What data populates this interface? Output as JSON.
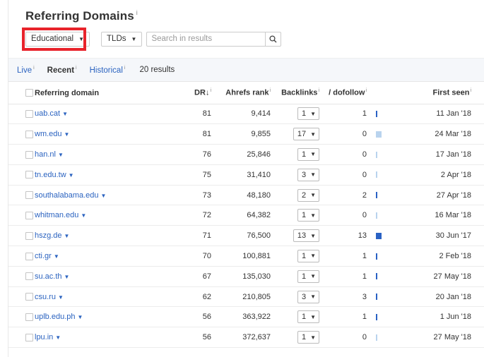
{
  "header": {
    "title": "Referring Domains",
    "title_info": "i"
  },
  "filters": {
    "category_label": "Educational",
    "tlds_label": "TLDs",
    "search_placeholder": "Search in results"
  },
  "tabs": [
    {
      "label": "Live",
      "info": "i"
    },
    {
      "label": "Recent",
      "info": "i"
    },
    {
      "label": "Historical",
      "info": "i"
    }
  ],
  "results_count": "20 results",
  "columns": {
    "domain": "Referring domain",
    "dr": "DR",
    "dr_sort_icon": "↓",
    "dr_info": "i",
    "rank": "Ahrefs rank",
    "rank_info": "i",
    "backlinks": "Backlinks",
    "backlinks_info": "i",
    "dofollow": "/ dofollow",
    "dofollow_info": "i",
    "first_seen": "First seen",
    "first_seen_info": "i"
  },
  "rows": [
    {
      "domain": "uab.cat",
      "dr": "81",
      "rank": "9,414",
      "backlinks": "1",
      "dofollow": "1",
      "first_seen": "11 Jan '18"
    },
    {
      "domain": "wm.edu",
      "dr": "81",
      "rank": "9,855",
      "backlinks": "17",
      "dofollow": "0",
      "first_seen": "24 Mar '18"
    },
    {
      "domain": "han.nl",
      "dr": "76",
      "rank": "25,846",
      "backlinks": "1",
      "dofollow": "0",
      "first_seen": "17 Jan '18"
    },
    {
      "domain": "tn.edu.tw",
      "dr": "75",
      "rank": "31,410",
      "backlinks": "3",
      "dofollow": "0",
      "first_seen": "2 Apr '18"
    },
    {
      "domain": "southalabama.edu",
      "dr": "73",
      "rank": "48,180",
      "backlinks": "2",
      "dofollow": "2",
      "first_seen": "27 Apr '18"
    },
    {
      "domain": "whitman.edu",
      "dr": "72",
      "rank": "64,382",
      "backlinks": "1",
      "dofollow": "0",
      "first_seen": "16 Mar '18"
    },
    {
      "domain": "hszg.de",
      "dr": "71",
      "rank": "76,500",
      "backlinks": "13",
      "dofollow": "13",
      "first_seen": "30 Jun '17"
    },
    {
      "domain": "cti.gr",
      "dr": "70",
      "rank": "100,881",
      "backlinks": "1",
      "dofollow": "1",
      "first_seen": "2 Feb '18"
    },
    {
      "domain": "su.ac.th",
      "dr": "67",
      "rank": "135,030",
      "backlinks": "1",
      "dofollow": "1",
      "first_seen": "27 May '18"
    },
    {
      "domain": "csu.ru",
      "dr": "62",
      "rank": "210,805",
      "backlinks": "3",
      "dofollow": "3",
      "first_seen": "20 Jan '18"
    },
    {
      "domain": "uplb.edu.ph",
      "dr": "56",
      "rank": "363,922",
      "backlinks": "1",
      "dofollow": "1",
      "first_seen": "1 Jun '18"
    },
    {
      "domain": "lpu.in",
      "dr": "56",
      "rank": "372,637",
      "backlinks": "1",
      "dofollow": "0",
      "first_seen": "27 May '18"
    }
  ],
  "colors": {
    "link": "#2b63c0",
    "highlight_border": "#e8232b",
    "bar_dofollow": "#2a62c4",
    "bar_nofollow": "#b9d3ee"
  },
  "icons": {
    "dropdown": "caret-down-icon",
    "search": "magnifier-icon",
    "sort": "arrow-down-icon"
  }
}
